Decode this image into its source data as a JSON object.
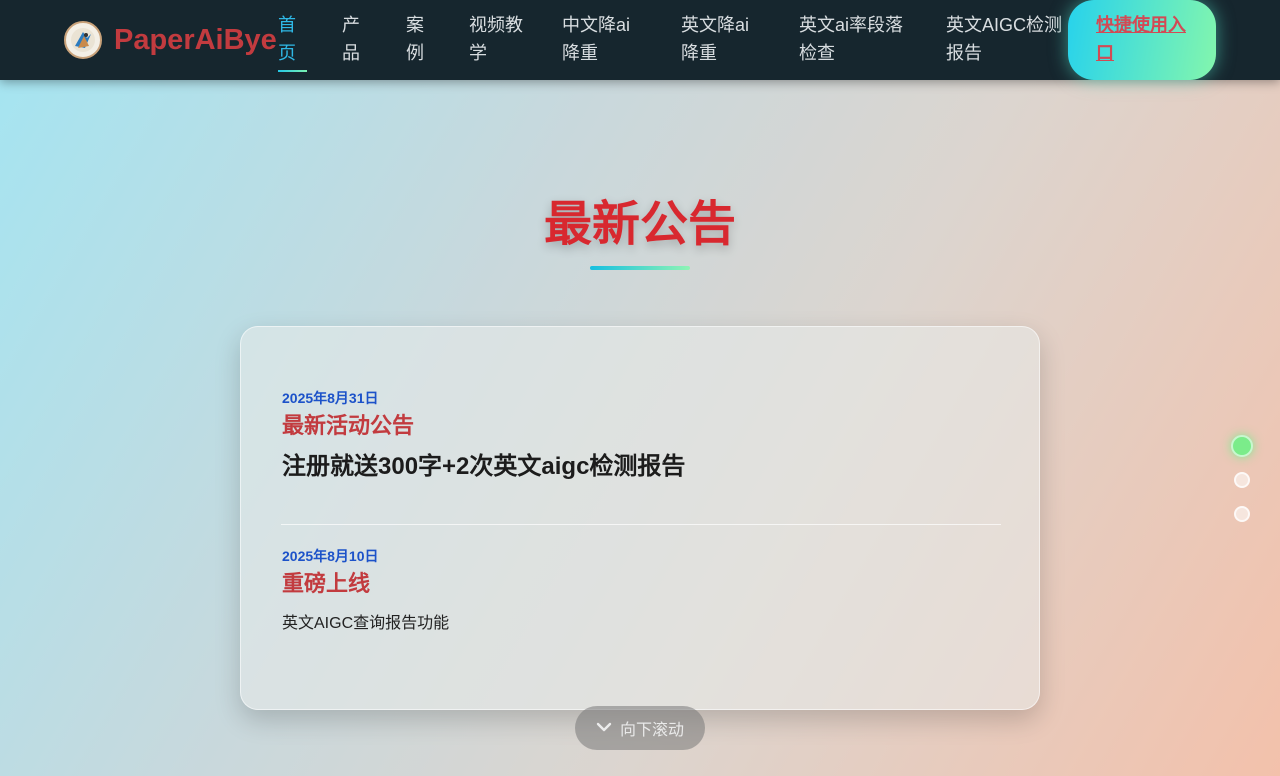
{
  "nav": {
    "brand": "PaperAiBye",
    "items": [
      {
        "line1": "首",
        "line2": "页",
        "active": true
      },
      {
        "line1": "产",
        "line2": "品"
      },
      {
        "line1": "案",
        "line2": "例"
      },
      {
        "line1": "视频教",
        "line2": "学"
      },
      {
        "line1": "中文降ai",
        "line2": "降重"
      },
      {
        "line1": "英文降ai",
        "line2": "降重"
      },
      {
        "line1": "英文ai率段落",
        "line2": "检查"
      },
      {
        "line1": "英文AIGC检测",
        "line2": "报告"
      }
    ],
    "cta_label": "快捷使用入口"
  },
  "hero": {
    "title": "最新公告"
  },
  "announcements": [
    {
      "date": "2025年8月31日",
      "title": "最新活动公告",
      "content": "注册就送300字+2次英文aigc检测报告"
    },
    {
      "date": "2025年8月10日",
      "title": "重磅上线",
      "content": "英文AIGC查询报告功能"
    }
  ],
  "scroll_hint": {
    "label": "向下滚动",
    "icon": "chevron-down-icon"
  },
  "page_dots": {
    "count": 3,
    "active_index": 0
  },
  "colors": {
    "nav_bg": "#16262e",
    "brand_red": "#c23b3f",
    "title_red": "#d8282f",
    "active_blue": "#2fb8e6",
    "date_blue": "#1c52c9",
    "accent_gradient_start": "#22c7e6",
    "accent_gradient_end": "#7bf2b0"
  }
}
